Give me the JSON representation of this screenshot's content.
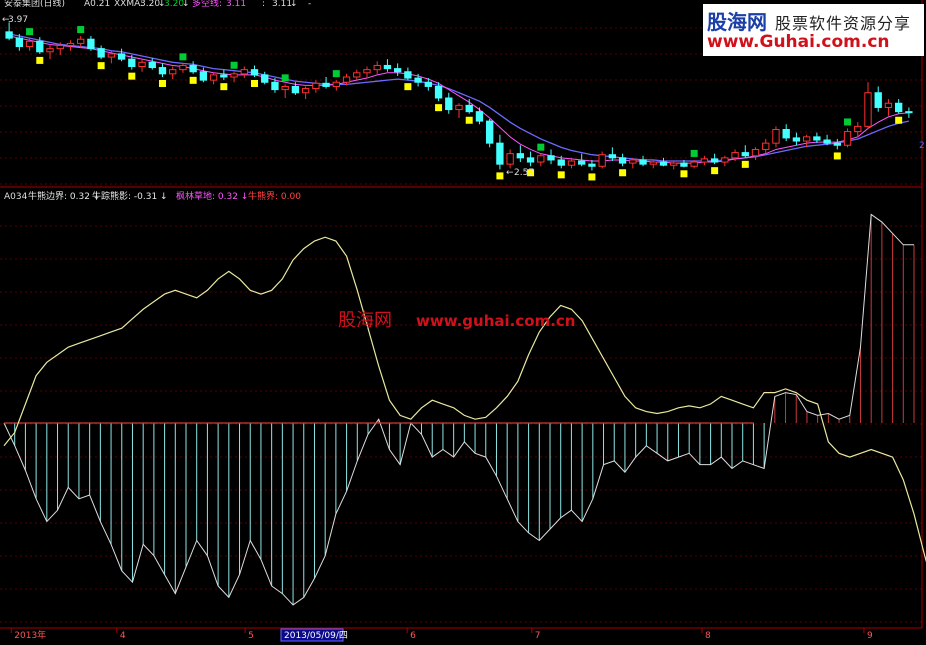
{
  "upper_legend": {
    "stock": "安泰集团(日线)",
    "a_value": "A0.21",
    "xxma_label": "XXMA:",
    "xxma_value": "3.20",
    "xxma_value2": "3.20",
    "dkx_label": "多空线:",
    "dkx_value": "3.11",
    "extra_value": "3.11"
  },
  "lower_legend": {
    "prefix": "A034",
    "items": [
      {
        "label": "牛熊边界:",
        "value": "0.32",
        "arrow": "↓",
        "color": "#e6e6e6"
      },
      {
        "label": "牛踪熊影:",
        "value": "-0.31",
        "arrow": "↓",
        "color": "#e6e6e6"
      },
      {
        "label": "枫林草地:",
        "value": "0.32",
        "arrow": "↓",
        "color": "#ff55ff"
      },
      {
        "label": "牛熊界:",
        "value": "0.00",
        "arrow": "",
        "color": "#ff4444"
      }
    ]
  },
  "x_axis": {
    "labels": [
      {
        "text": "2013年",
        "pos": 0.008
      },
      {
        "text": "4",
        "pos": 0.124
      },
      {
        "text": "5",
        "pos": 0.265
      },
      {
        "text": "6",
        "pos": 0.443
      },
      {
        "text": "7",
        "pos": 0.58
      },
      {
        "text": "8",
        "pos": 0.767
      },
      {
        "text": "9",
        "pos": 0.945
      }
    ],
    "cursor_date": "2013/05/09/四",
    "cursor_pos": 0.34
  },
  "annotations": {
    "high": "3.97",
    "low": "2.57",
    "right_mark": "2"
  },
  "watermark": {
    "brand_cn": "股海网",
    "slogan_cn": "股票软件资源分享",
    "url": "www.Guhai.com.cn",
    "mid_brand_cn": "股海网",
    "mid_url": "www.guhai.com.cn"
  },
  "colors": {
    "up_candle": "#ff3030",
    "down_candle": "#44ffff",
    "ma_line": "#6a6aff",
    "dkx_line": "#ff55ff",
    "marker_yellow": "#ffff00",
    "marker_green": "#00cc33",
    "osc_line": "#e8e8a0",
    "pos_hatch": "#c83a3a",
    "neg_hatch": "#8ee6e6",
    "divider": "#aa0000"
  },
  "chart_data": [
    {
      "type": "candlestick",
      "title": "安泰集团(日线)",
      "ylim": [
        2.45,
        4.05
      ],
      "candles": [
        [
          3.88,
          3.97,
          3.8,
          3.82
        ],
        [
          3.82,
          3.86,
          3.7,
          3.74
        ],
        [
          3.74,
          3.82,
          3.7,
          3.79
        ],
        [
          3.79,
          3.83,
          3.67,
          3.69
        ],
        [
          3.69,
          3.76,
          3.62,
          3.72
        ],
        [
          3.72,
          3.78,
          3.66,
          3.75
        ],
        [
          3.75,
          3.8,
          3.7,
          3.77
        ],
        [
          3.77,
          3.84,
          3.73,
          3.81
        ],
        [
          3.81,
          3.84,
          3.7,
          3.72
        ],
        [
          3.72,
          3.75,
          3.62,
          3.64
        ],
        [
          3.64,
          3.7,
          3.58,
          3.67
        ],
        [
          3.67,
          3.72,
          3.6,
          3.62
        ],
        [
          3.62,
          3.66,
          3.52,
          3.55
        ],
        [
          3.55,
          3.62,
          3.5,
          3.59
        ],
        [
          3.59,
          3.63,
          3.52,
          3.54
        ],
        [
          3.54,
          3.58,
          3.45,
          3.48
        ],
        [
          3.48,
          3.55,
          3.43,
          3.52
        ],
        [
          3.52,
          3.58,
          3.49,
          3.56
        ],
        [
          3.56,
          3.6,
          3.48,
          3.5
        ],
        [
          3.5,
          3.54,
          3.4,
          3.42
        ],
        [
          3.42,
          3.5,
          3.38,
          3.47
        ],
        [
          3.47,
          3.52,
          3.42,
          3.45
        ],
        [
          3.45,
          3.5,
          3.4,
          3.48
        ],
        [
          3.48,
          3.55,
          3.44,
          3.52
        ],
        [
          3.52,
          3.56,
          3.45,
          3.47
        ],
        [
          3.47,
          3.5,
          3.38,
          3.4
        ],
        [
          3.4,
          3.44,
          3.3,
          3.33
        ],
        [
          3.33,
          3.38,
          3.25,
          3.36
        ],
        [
          3.36,
          3.4,
          3.28,
          3.3
        ],
        [
          3.3,
          3.36,
          3.24,
          3.34
        ],
        [
          3.34,
          3.42,
          3.3,
          3.39
        ],
        [
          3.39,
          3.45,
          3.34,
          3.36
        ],
        [
          3.36,
          3.42,
          3.32,
          3.4
        ],
        [
          3.4,
          3.48,
          3.37,
          3.45
        ],
        [
          3.45,
          3.52,
          3.42,
          3.49
        ],
        [
          3.49,
          3.55,
          3.44,
          3.52
        ],
        [
          3.52,
          3.6,
          3.48,
          3.56
        ],
        [
          3.56,
          3.62,
          3.5,
          3.53
        ],
        [
          3.53,
          3.58,
          3.46,
          3.5
        ],
        [
          3.5,
          3.54,
          3.42,
          3.44
        ],
        [
          3.44,
          3.48,
          3.36,
          3.4
        ],
        [
          3.4,
          3.44,
          3.32,
          3.36
        ],
        [
          3.36,
          3.4,
          3.22,
          3.25
        ],
        [
          3.25,
          3.3,
          3.1,
          3.14
        ],
        [
          3.14,
          3.2,
          3.06,
          3.18
        ],
        [
          3.18,
          3.24,
          3.1,
          3.12
        ],
        [
          3.12,
          3.16,
          3.0,
          3.03
        ],
        [
          3.03,
          3.05,
          2.78,
          2.82
        ],
        [
          2.82,
          2.9,
          2.57,
          2.62
        ],
        [
          2.62,
          2.76,
          2.58,
          2.72
        ],
        [
          2.72,
          2.8,
          2.64,
          2.68
        ],
        [
          2.68,
          2.74,
          2.6,
          2.64
        ],
        [
          2.64,
          2.72,
          2.6,
          2.7
        ],
        [
          2.7,
          2.76,
          2.62,
          2.66
        ],
        [
          2.66,
          2.7,
          2.58,
          2.61
        ],
        [
          2.61,
          2.68,
          2.58,
          2.65
        ],
        [
          2.65,
          2.72,
          2.6,
          2.62
        ],
        [
          2.62,
          2.66,
          2.56,
          2.6
        ],
        [
          2.6,
          2.74,
          2.58,
          2.71
        ],
        [
          2.71,
          2.78,
          2.65,
          2.68
        ],
        [
          2.68,
          2.72,
          2.6,
          2.63
        ],
        [
          2.63,
          2.68,
          2.58,
          2.66
        ],
        [
          2.66,
          2.7,
          2.6,
          2.62
        ],
        [
          2.62,
          2.66,
          2.58,
          2.64
        ],
        [
          2.64,
          2.68,
          2.6,
          2.61
        ],
        [
          2.61,
          2.65,
          2.57,
          2.63
        ],
        [
          2.63,
          2.66,
          2.59,
          2.6
        ],
        [
          2.6,
          2.66,
          2.58,
          2.64
        ],
        [
          2.64,
          2.7,
          2.61,
          2.67
        ],
        [
          2.67,
          2.72,
          2.62,
          2.64
        ],
        [
          2.64,
          2.7,
          2.6,
          2.68
        ],
        [
          2.68,
          2.76,
          2.65,
          2.73
        ],
        [
          2.73,
          2.8,
          2.68,
          2.7
        ],
        [
          2.7,
          2.78,
          2.66,
          2.76
        ],
        [
          2.76,
          2.86,
          2.72,
          2.82
        ],
        [
          2.82,
          2.98,
          2.78,
          2.95
        ],
        [
          2.95,
          3.0,
          2.84,
          2.87
        ],
        [
          2.87,
          2.92,
          2.8,
          2.84
        ],
        [
          2.84,
          2.9,
          2.78,
          2.88
        ],
        [
          2.88,
          2.92,
          2.82,
          2.85
        ],
        [
          2.85,
          2.9,
          2.8,
          2.82
        ],
        [
          2.82,
          2.86,
          2.76,
          2.8
        ],
        [
          2.8,
          2.96,
          2.78,
          2.93
        ],
        [
          2.93,
          3.02,
          2.88,
          2.98
        ],
        [
          2.98,
          3.4,
          2.96,
          3.3
        ],
        [
          3.3,
          3.36,
          3.12,
          3.16
        ],
        [
          3.16,
          3.24,
          3.08,
          3.2
        ],
        [
          3.2,
          3.24,
          3.1,
          3.12
        ],
        [
          3.12,
          3.16,
          3.06,
          3.11
        ]
      ],
      "ma": [
        3.86,
        3.84,
        3.82,
        3.8,
        3.78,
        3.76,
        3.75,
        3.74,
        3.73,
        3.72,
        3.7,
        3.69,
        3.67,
        3.65,
        3.63,
        3.61,
        3.59,
        3.58,
        3.57,
        3.55,
        3.53,
        3.52,
        3.51,
        3.5,
        3.49,
        3.47,
        3.45,
        3.43,
        3.41,
        3.4,
        3.39,
        3.38,
        3.38,
        3.38,
        3.39,
        3.4,
        3.41,
        3.42,
        3.43,
        3.42,
        3.41,
        3.39,
        3.37,
        3.34,
        3.3,
        3.26,
        3.22,
        3.16,
        3.09,
        3.02,
        2.96,
        2.91,
        2.86,
        2.82,
        2.78,
        2.75,
        2.73,
        2.71,
        2.7,
        2.69,
        2.68,
        2.67,
        2.66,
        2.66,
        2.65,
        2.65,
        2.65,
        2.65,
        2.65,
        2.65,
        2.66,
        2.67,
        2.68,
        2.69,
        2.71,
        2.73,
        2.75,
        2.77,
        2.79,
        2.8,
        2.81,
        2.82,
        2.84,
        2.86,
        2.9,
        2.94,
        2.98,
        3.01,
        3.03
      ],
      "dkx": [
        3.84,
        3.82,
        3.8,
        3.78,
        3.76,
        3.75,
        3.74,
        3.73,
        3.72,
        3.7,
        3.68,
        3.66,
        3.64,
        3.62,
        3.6,
        3.58,
        3.56,
        3.55,
        3.53,
        3.51,
        3.49,
        3.48,
        3.47,
        3.47,
        3.47,
        3.45,
        3.42,
        3.4,
        3.38,
        3.37,
        3.37,
        3.37,
        3.38,
        3.4,
        3.42,
        3.44,
        3.47,
        3.49,
        3.49,
        3.48,
        3.46,
        3.43,
        3.39,
        3.33,
        3.27,
        3.21,
        3.14,
        3.06,
        2.97,
        2.88,
        2.81,
        2.76,
        2.72,
        2.7,
        2.68,
        2.67,
        2.66,
        2.65,
        2.65,
        2.66,
        2.66,
        2.65,
        2.65,
        2.64,
        2.64,
        2.63,
        2.63,
        2.63,
        2.64,
        2.64,
        2.65,
        2.67,
        2.68,
        2.7,
        2.72,
        2.76,
        2.78,
        2.8,
        2.82,
        2.83,
        2.83,
        2.83,
        2.85,
        2.88,
        2.96,
        3.02,
        3.07,
        3.1,
        3.11
      ]
    },
    {
      "type": "line",
      "title": "A034",
      "ylim": [
        -1.05,
        1.15
      ],
      "series": [
        {
          "name": "牛熊边界",
          "values": [
            -0.12,
            -0.05,
            0.1,
            0.25,
            0.32,
            0.36,
            0.4,
            0.42,
            0.44,
            0.46,
            0.48,
            0.5,
            0.55,
            0.6,
            0.64,
            0.68,
            0.7,
            0.68,
            0.66,
            0.7,
            0.76,
            0.8,
            0.76,
            0.7,
            0.68,
            0.7,
            0.76,
            0.86,
            0.92,
            0.96,
            0.98,
            0.96,
            0.88,
            0.7,
            0.5,
            0.3,
            0.12,
            0.04,
            0.02,
            0.08,
            0.12,
            0.1,
            0.08,
            0.04,
            0.02,
            0.03,
            0.08,
            0.14,
            0.22,
            0.36,
            0.48,
            0.56,
            0.62,
            0.6,
            0.54,
            0.44,
            0.34,
            0.24,
            0.14,
            0.08,
            0.06,
            0.05,
            0.06,
            0.08,
            0.09,
            0.08,
            0.1,
            0.14,
            0.12,
            0.1,
            0.08,
            0.16,
            0.16,
            0.18,
            0.16,
            0.12,
            0.1,
            -0.1,
            -0.16,
            -0.18,
            -0.16,
            -0.14,
            -0.16,
            -0.18,
            -0.3,
            -0.48,
            -0.7,
            -0.9,
            -0.98
          ]
        },
        {
          "name": "牛踪熊影",
          "values": [
            0.0,
            -0.12,
            -0.25,
            -0.4,
            -0.52,
            -0.46,
            -0.34,
            -0.4,
            -0.38,
            -0.52,
            -0.64,
            -0.78,
            -0.84,
            -0.64,
            -0.7,
            -0.8,
            -0.9,
            -0.76,
            -0.62,
            -0.7,
            -0.86,
            -0.92,
            -0.8,
            -0.62,
            -0.72,
            -0.86,
            -0.9,
            -0.96,
            -0.92,
            -0.82,
            -0.7,
            -0.48,
            -0.36,
            -0.2,
            -0.06,
            0.02,
            -0.14,
            -0.22,
            0.0,
            -0.06,
            -0.18,
            -0.14,
            -0.18,
            -0.1,
            -0.16,
            -0.18,
            -0.28,
            -0.4,
            -0.52,
            -0.58,
            -0.62,
            -0.56,
            -0.5,
            -0.46,
            -0.52,
            -0.4,
            -0.22,
            -0.2,
            -0.26,
            -0.18,
            -0.12,
            -0.16,
            -0.2,
            -0.18,
            -0.16,
            -0.22,
            -0.22,
            -0.18,
            -0.24,
            -0.2,
            -0.22,
            -0.24,
            0.14,
            0.16,
            0.15,
            0.06,
            0.04,
            0.05,
            0.02,
            0.04,
            0.4,
            1.1,
            1.06,
            1.0,
            0.94,
            0.94
          ]
        }
      ],
      "zero_line": 0,
      "grid": true
    }
  ]
}
